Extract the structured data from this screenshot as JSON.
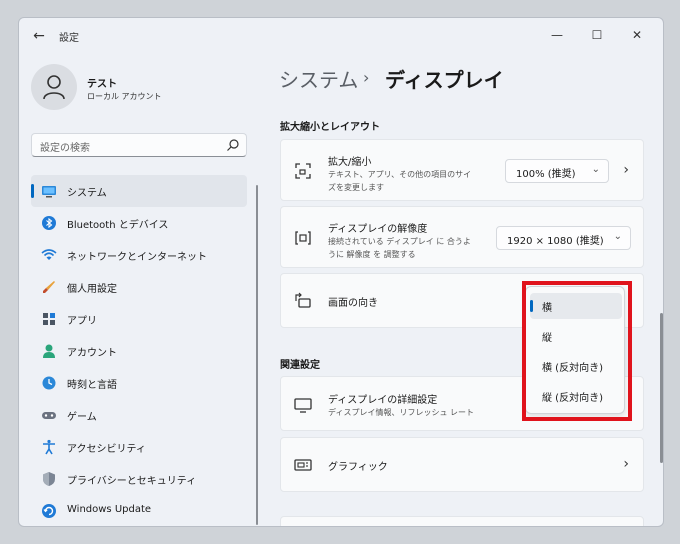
{
  "window": {
    "title": "設定",
    "back_icon": "back-arrow-icon",
    "controls": [
      "minimize",
      "maximize",
      "close"
    ]
  },
  "profile": {
    "name": "テスト",
    "account_type": "ローカル アカウント"
  },
  "search": {
    "placeholder": "設定の検索"
  },
  "sidebar": {
    "items": [
      {
        "label": "システム",
        "icon": "system-icon",
        "active": true
      },
      {
        "label": "Bluetooth とデバイス",
        "icon": "bluetooth-icon"
      },
      {
        "label": "ネットワークとインターネット",
        "icon": "network-icon"
      },
      {
        "label": "個人用設定",
        "icon": "personalization-icon"
      },
      {
        "label": "アプリ",
        "icon": "apps-icon"
      },
      {
        "label": "アカウント",
        "icon": "accounts-icon"
      },
      {
        "label": "時刻と言語",
        "icon": "time-language-icon"
      },
      {
        "label": "ゲーム",
        "icon": "gaming-icon"
      },
      {
        "label": "アクセシビリティ",
        "icon": "accessibility-icon"
      },
      {
        "label": "プライバシーとセキュリティ",
        "icon": "privacy-icon"
      },
      {
        "label": "Windows Update",
        "icon": "windows-update-icon"
      }
    ]
  },
  "breadcrumb": {
    "root": "システム",
    "separator": "›",
    "current": "ディスプレイ"
  },
  "scale_layout": {
    "section_title": "拡大縮小とレイアウト",
    "scale": {
      "title": "拡大/縮小",
      "desc": "テキスト、アプリ、その他の項目のサイズを変更します",
      "value": "100% (推奨)"
    },
    "resolution": {
      "title": "ディスプレイの解像度",
      "desc": "接続されている ディスプレイ に 合うように 解像度 を 調整する",
      "value": "1920 × 1080 (推奨)"
    },
    "orientation": {
      "title": "画面の向き",
      "options": [
        "横",
        "縦",
        "横 (反対向き)",
        "縦 (反対向き)"
      ],
      "selected": "横"
    }
  },
  "related": {
    "section_title": "関連設定",
    "advanced_display": {
      "title": "ディスプレイの詳細設定",
      "desc": "ディスプレイ情報、リフレッシュ レート"
    },
    "graphics": {
      "title": "グラフィック"
    }
  },
  "colors": {
    "accent": "#0067c0",
    "highlight": "#e0131c",
    "background": "#eef1f6"
  }
}
